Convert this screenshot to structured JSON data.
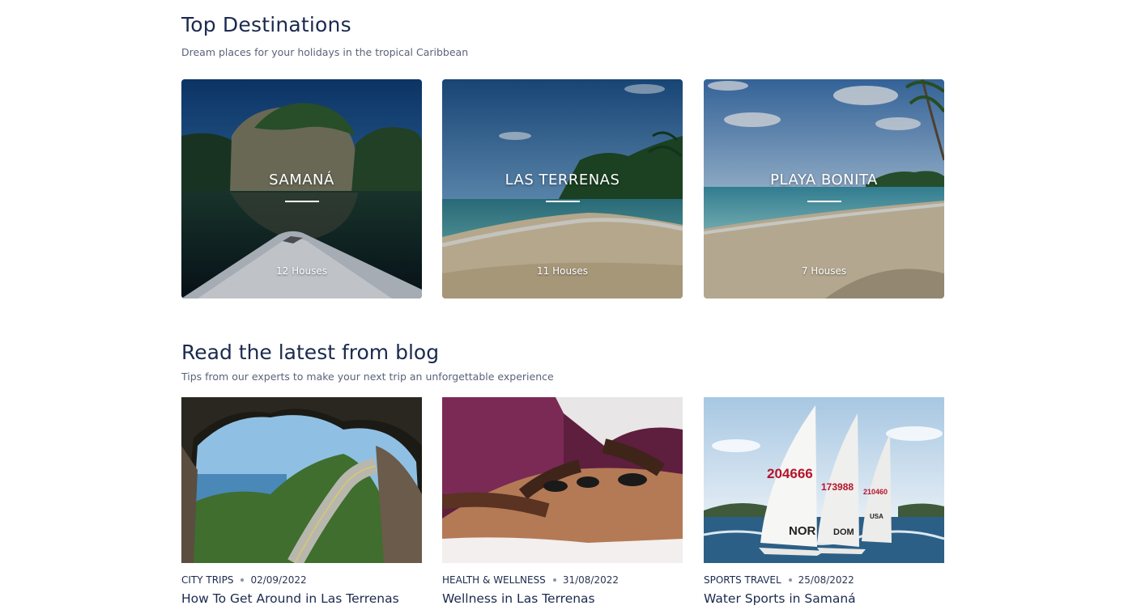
{
  "destinations": {
    "title": "Top Destinations",
    "subtitle": "Dream places for your holidays in the tropical Caribbean",
    "cards": [
      {
        "name": "SAMANÁ",
        "count": "12 Houses"
      },
      {
        "name": "LAS TERRENAS",
        "count": "11 Houses"
      },
      {
        "name": "PLAYA BONITA",
        "count": "7 Houses"
      }
    ]
  },
  "blog": {
    "title": "Read the latest from blog",
    "subtitle": "Tips from our experts to make your next trip an unforgettable experience",
    "posts": [
      {
        "category": "CITY TRIPS",
        "date": "02/09/2022",
        "title": "How To Get Around in Las Terrenas"
      },
      {
        "category": "HEALTH & WELLNESS",
        "date": "31/08/2022",
        "title": "Wellness in Las Terrenas"
      },
      {
        "category": "SPORTS TRAVEL",
        "date": "25/08/2022",
        "title": "Water Sports in Samaná"
      }
    ],
    "sail_numbers": [
      "204666",
      "173988",
      "210460"
    ],
    "sail_flags": [
      "NOR",
      "DOM",
      "USA"
    ]
  }
}
